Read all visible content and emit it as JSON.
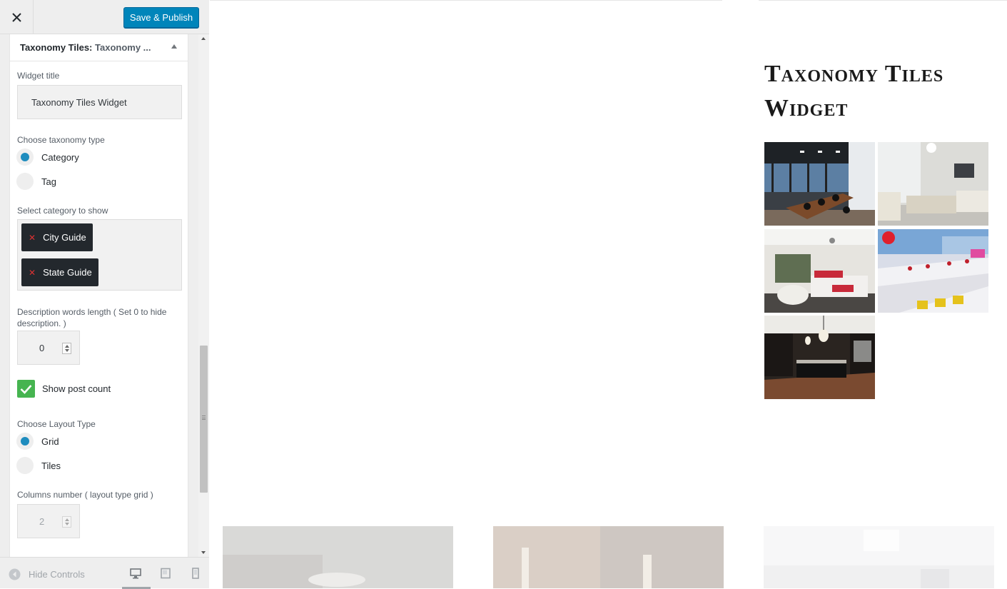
{
  "header": {
    "save_label": "Save & Publish"
  },
  "widget": {
    "title_bold": "Taxonomy Tiles:",
    "title_rest": " Taxonomy ...",
    "widget_title_label": "Widget title",
    "widget_title_value": "Taxonomy Tiles Widget",
    "taxonomy_label": "Choose taxonomy type",
    "taxonomy_options": [
      {
        "label": "Category",
        "selected": true
      },
      {
        "label": "Tag",
        "selected": false
      }
    ],
    "category_label": "Select category to show",
    "selected_categories": [
      "City Guide",
      "State Guide"
    ],
    "description_label": "Description words length ( Set 0 to hide description. )",
    "description_value": "0",
    "show_post_count_label": "Show post count",
    "show_post_count": true,
    "layout_label": "Choose Layout Type",
    "layout_options": [
      {
        "label": "Grid",
        "selected": true
      },
      {
        "label": "Tiles",
        "selected": false
      }
    ],
    "columns_label": "Columns number ( layout type grid )",
    "columns_value": "2"
  },
  "footer": {
    "hide_controls_label": "Hide Controls"
  },
  "preview": {
    "widget_title": "Taxonomy Tiles Widget",
    "tiles": [
      "conference-room-image",
      "living-room-image",
      "bedroom-image",
      "dining-room-image",
      "kitchen-image"
    ]
  },
  "colors": {
    "accent": "#0085ba",
    "radio_on": "#1e8cbe",
    "checkbox": "#46b450",
    "chip": "#23282d"
  }
}
